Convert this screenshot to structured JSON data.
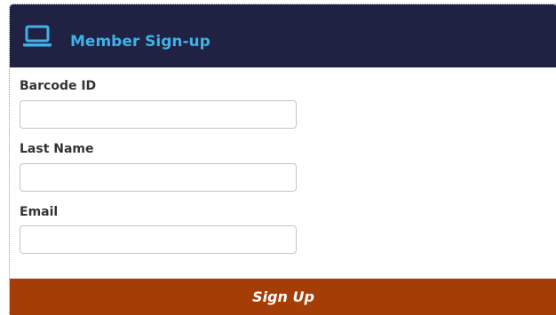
{
  "header": {
    "icon": "laptop-icon",
    "title": "Member Sign-up"
  },
  "form": {
    "fields": [
      {
        "label": "Barcode ID",
        "value": "",
        "placeholder": ""
      },
      {
        "label": "Last Name",
        "value": "",
        "placeholder": ""
      },
      {
        "label": "Email",
        "value": "",
        "placeholder": ""
      }
    ],
    "submit_label": "Sign Up"
  },
  "colors": {
    "header_bg": "#1f2243",
    "accent": "#3fb1e6",
    "button_bg": "#a53d07",
    "button_text": "#ffffff"
  }
}
